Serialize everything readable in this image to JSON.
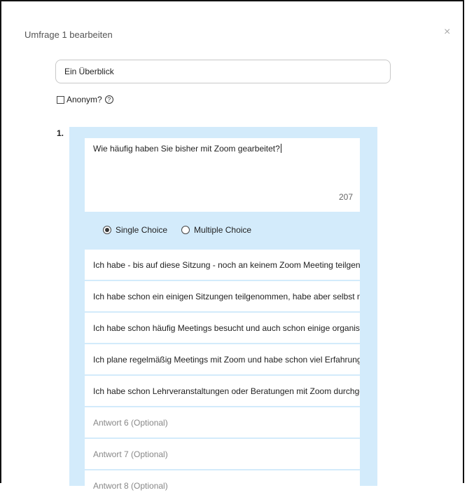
{
  "dialog": {
    "title": "Umfrage 1 bearbeiten",
    "close_glyph": "×",
    "poll_name": "Ein Überblick",
    "anonymous_label": "Anonym?",
    "help_glyph": "?"
  },
  "question": {
    "number": "1.",
    "text": "Wie häufig haben Sie bisher mit Zoom gearbeitet?",
    "remaining_chars": "207",
    "type_single": "Single Choice",
    "type_multiple": "Multiple Choice",
    "selected_type": "single"
  },
  "answers": [
    {
      "text": "Ich habe - bis auf diese Sitzung - noch an keinem Zoom Meeting teilgenommen.",
      "placeholder": false
    },
    {
      "text": "Ich habe schon ein einigen Sitzungen teilgenommen, habe aber selbst noch keine organisiert.",
      "placeholder": false
    },
    {
      "text": "Ich habe schon häufig Meetings besucht und auch schon einige organisiert.",
      "placeholder": false
    },
    {
      "text": "Ich plane regelmäßig Meetings mit Zoom und habe schon viel Erfahrung.",
      "placeholder": false
    },
    {
      "text": "Ich habe schon Lehrveranstaltungen oder Beratungen mit Zoom durchgeführt.",
      "placeholder": false
    },
    {
      "text": "Antwort 6 (Optional)",
      "placeholder": true
    },
    {
      "text": "Antwort 7 (Optional)",
      "placeholder": true
    },
    {
      "text": "Antwort 8 (Optional)",
      "placeholder": true
    }
  ],
  "icons": {
    "close": "close-icon",
    "help": "help-circle-icon",
    "checkbox": "checkbox-icon",
    "radio": "radio-icon"
  }
}
